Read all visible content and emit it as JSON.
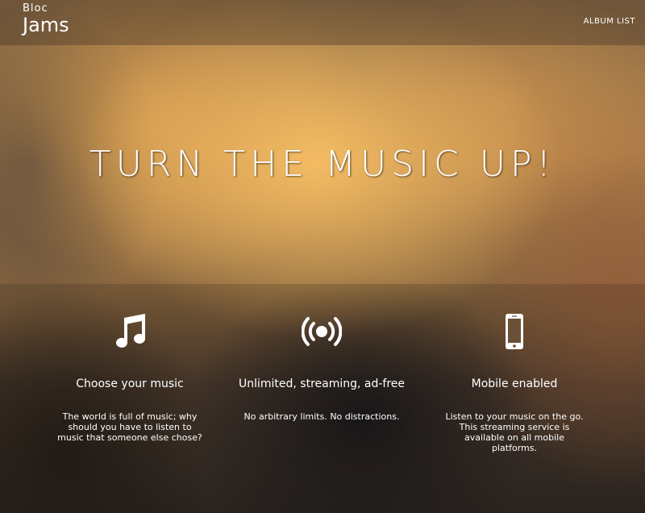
{
  "navbar": {
    "logo_top": "Bloc",
    "logo_bottom": "Jams",
    "album_list_label": "ALBUM LIST"
  },
  "hero": {
    "title": "TURN THE MUSIC UP!"
  },
  "selling_points": [
    {
      "icon": "music-note-icon",
      "title": "Choose your music",
      "description": "The world is full of music; why should you have to listen to music that someone else chose?"
    },
    {
      "icon": "broadcast-icon",
      "title": "Unlimited, streaming, ad-free",
      "description": "No arbitrary limits. No distractions."
    },
    {
      "icon": "mobile-phone-icon",
      "title": "Mobile enabled",
      "description": "Listen to your music on the go. This streaming service is available on all mobile platforms."
    }
  ]
}
